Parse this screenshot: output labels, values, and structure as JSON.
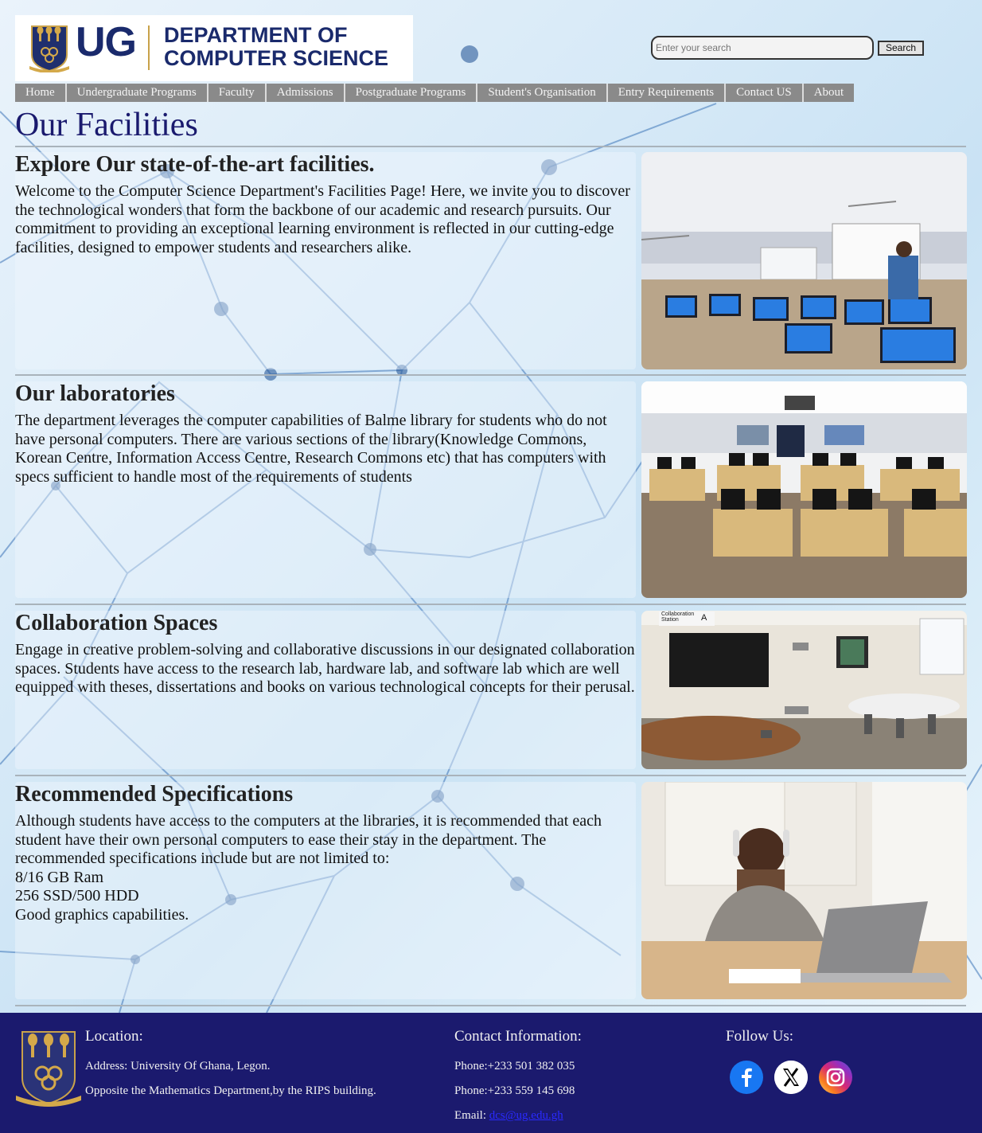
{
  "header": {
    "logo_ug": "UG",
    "logo_dept_line1": "DEPARTMENT OF",
    "logo_dept_line2": "COMPUTER SCIENCE",
    "search_placeholder": "Enter your search",
    "search_button": "Search"
  },
  "nav": {
    "items": [
      {
        "label": "Home"
      },
      {
        "label": "Undergraduate Programs"
      },
      {
        "label": "Faculty"
      },
      {
        "label": "Admissions"
      },
      {
        "label": "Postgraduate Programs"
      },
      {
        "label": "Student's Organisation"
      },
      {
        "label": "Entry Requirements"
      },
      {
        "label": "Contact US"
      },
      {
        "label": "About"
      }
    ]
  },
  "page": {
    "title": "Our Facilities"
  },
  "sections": [
    {
      "heading": "Explore Our state-of-the-art facilities.",
      "text": "Welcome to the Computer Science Department's Facilities Page! Here, we invite you to discover the technological wonders that form the backbone of our academic and research pursuits. Our commitment to providing an exceptional learning environment is reflected in our cutting-edge facilities, designed to empower students and researchers alike.",
      "image": "computer-lab-class-photo"
    },
    {
      "heading": "Our laboratories",
      "text": "The department leverages the computer capabilities of Balme library for students who do not have personal computers. There are various sections of the library(Knowledge Commons, Korean Centre, Information Access Centre, Research Commons etc) that has computers with specs sufficient to handle most of the requirements of students",
      "image": "empty-computer-lab-photo"
    },
    {
      "heading": "Collaboration Spaces",
      "text": "Engage in creative problem-solving and collaborative discussions in our designated collaboration spaces. Students have access to the research lab, hardware lab, and software lab which are well equipped with theses, dissertations and books on various technological concepts for their perusal.",
      "image": "collaboration-room-photo",
      "image_sign": "Collaboration Station",
      "image_sign_letter": "A"
    },
    {
      "heading": "Recommended Specifications",
      "text_lines": [
        "Although students have access to the computers at the libraries, it is recommended that each student have their own personal computers to ease their stay in the department. The recommended specifications include but are not limited to:",
        "8/16 GB Ram",
        "256 SSD/500 HDD",
        "Good graphics capabilities."
      ],
      "image": "student-with-laptop-photo"
    }
  ],
  "footer": {
    "location_heading": "Location:",
    "address": "Address: University Of Ghana, Legon.",
    "landmark": "Opposite the Mathematics Department,by the RIPS building.",
    "contact_heading": "Contact Information:",
    "phone1": "Phone:+233 501 382 035",
    "phone2": "Phone:+233 559 145 698",
    "email_label": "Email:",
    "email_link": "dcs@ug.edu.gh",
    "follow_heading": "Follow Us:",
    "social": [
      {
        "icon": "facebook-icon",
        "color": "#1877f2"
      },
      {
        "icon": "x-icon",
        "color": "#000000"
      },
      {
        "icon": "instagram-icon",
        "color": "#d62976"
      }
    ]
  },
  "colors": {
    "title": "#1a1a6e",
    "logo_blue": "#1a2a6c",
    "nav_bg": "#8a8a8a",
    "footer_bg": "#1b1a6e"
  }
}
